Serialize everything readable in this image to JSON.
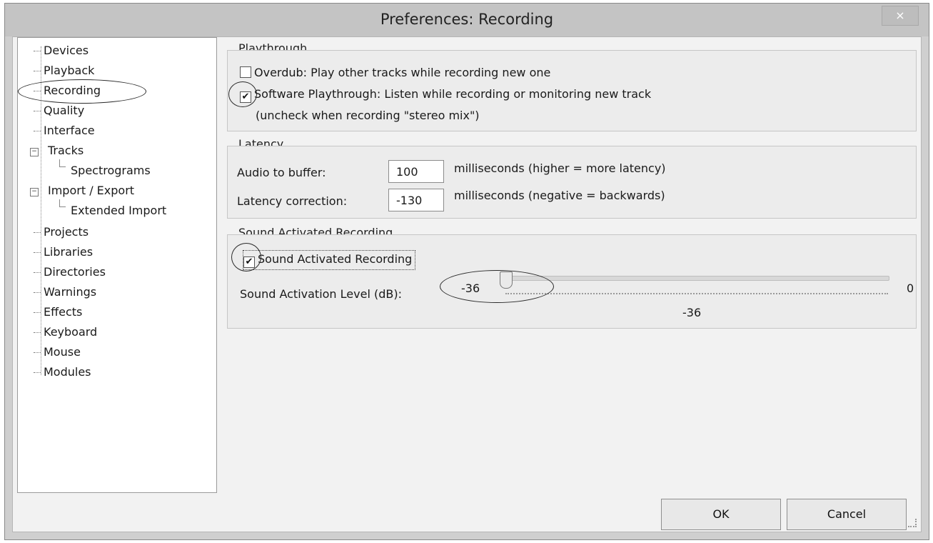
{
  "window": {
    "title": "Preferences: Recording",
    "close_label": "×"
  },
  "tree": {
    "items": [
      {
        "label": "Devices"
      },
      {
        "label": "Playback"
      },
      {
        "label": "Recording"
      },
      {
        "label": "Quality"
      },
      {
        "label": "Interface"
      },
      {
        "label": "Tracks"
      },
      {
        "label": "Spectrograms"
      },
      {
        "label": "Import / Export"
      },
      {
        "label": "Extended Import"
      },
      {
        "label": "Projects"
      },
      {
        "label": "Libraries"
      },
      {
        "label": "Directories"
      },
      {
        "label": "Warnings"
      },
      {
        "label": "Effects"
      },
      {
        "label": "Keyboard"
      },
      {
        "label": "Mouse"
      },
      {
        "label": "Modules"
      }
    ],
    "selected": "Recording"
  },
  "playthrough": {
    "title": "Playthrough",
    "overdub_label": "Overdub: Play other tracks while recording new one",
    "overdub_checked": false,
    "software_label": "Software Playthrough: Listen while recording or monitoring new track",
    "software_checked": true,
    "software_note": "(uncheck when recording \"stereo mix\")"
  },
  "latency": {
    "title": "Latency",
    "buffer_label": "Audio to buffer:",
    "buffer_value": "100",
    "buffer_note": "milliseconds (higher = more latency)",
    "correction_label": "Latency correction:",
    "correction_value": "-130",
    "correction_note": "milliseconds (negative = backwards)"
  },
  "sound_activated": {
    "title": "Sound Activated Recording",
    "checkbox_label": "Sound Activated Recording",
    "checked": true,
    "level_label": "Sound Activation Level (dB):",
    "slider_min_label": "-36",
    "slider_max_label": "0",
    "current_value": "-36",
    "slider_fraction": 0
  },
  "buttons": {
    "ok": "OK",
    "cancel": "Cancel"
  },
  "check_glyph": "✔"
}
